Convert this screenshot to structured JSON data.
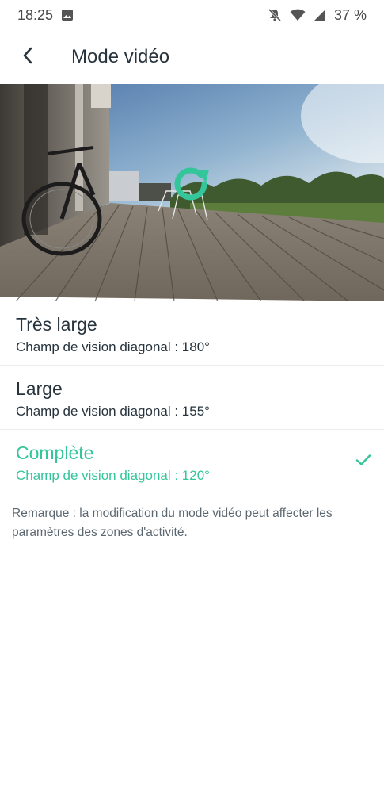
{
  "status_bar": {
    "time": "18:25",
    "battery": "37 %",
    "icons": [
      "image-icon",
      "mute-icon",
      "wifi-icon",
      "signal-icon"
    ]
  },
  "app_bar": {
    "back_icon": "chevron-left-icon",
    "title": "Mode vidéo"
  },
  "preview": {
    "overlay_icon": "refresh-icon",
    "accent_color": "#35c59a"
  },
  "options": [
    {
      "name": "Très large",
      "description": "Champ de vision diagonal : 180°",
      "selected": false
    },
    {
      "name": "Large",
      "description": "Champ de vision diagonal : 155°",
      "selected": false
    },
    {
      "name": "Complète",
      "description": "Champ de vision diagonal : 120°",
      "selected": true
    }
  ],
  "note": "Remarque : la modification du mode vidéo peut affecter les paramètres des zones d'activité.",
  "colors": {
    "accent": "#35c59a",
    "text": "#27343e",
    "secondary_text": "#5c6770"
  }
}
